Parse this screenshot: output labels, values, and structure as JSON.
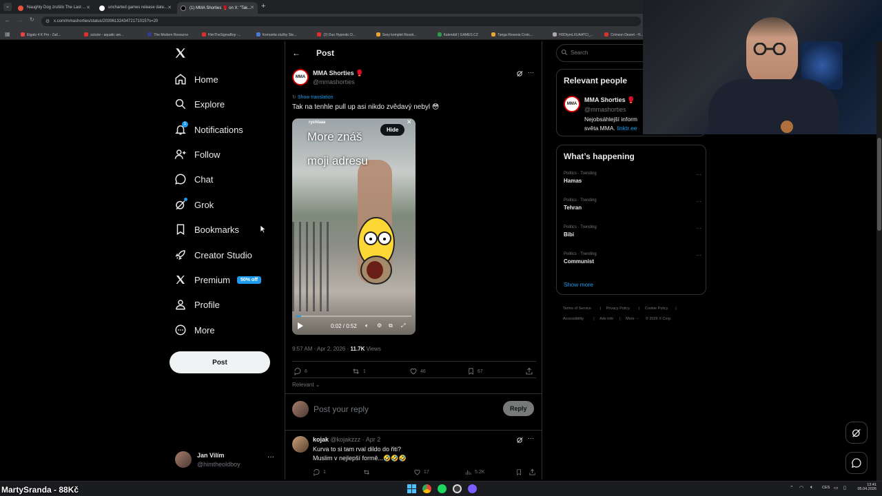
{
  "browser": {
    "tabs": [
      {
        "title": "Naughty Dog zrušilo The Last ...",
        "fav_color": "#e5533d"
      },
      {
        "title": "uncharted games release date...",
        "fav_color": "#ffffff"
      },
      {
        "title": "(1) MMA Shorties 🥊 on X: \"Tak...",
        "fav_color": "#000000"
      }
    ],
    "url": "x.com/mmashorties/status/2039613243472171015?s=20",
    "bookmarks": [
      {
        "label": "Elgato 4 K Pro - Zač...",
        "color": "#e94343"
      },
      {
        "label": "scizzie - aquatic am...",
        "color": "#e02f2f"
      },
      {
        "label": "The Modern Resource",
        "color": "#333a8f"
      },
      {
        "label": "HimTheSigmaBoy -...",
        "color": "#e02f2f"
      },
      {
        "label": "Komunita služby Ste...",
        "color": "#4c7bd6"
      },
      {
        "label": "(2) Duo Hypnotic D...",
        "color": "#e02f2f"
      },
      {
        "label": "Sexy komplet Roxeii...",
        "color": "#e8a531"
      },
      {
        "label": "Kalendář | GAMES.CZ",
        "color": "#2e9b4c"
      },
      {
        "label": "Tanga Roxenia Crotc...",
        "color": "#e8a531"
      },
      {
        "label": "HDDtymLXUAATCl_...",
        "color": "#aaaaaa"
      },
      {
        "label": "Crimson Desert - H...",
        "color": "#e02f2f"
      },
      {
        "label": "CRIMSON DESERT",
        "color": "#e02f2f"
      }
    ]
  },
  "nav": {
    "items": [
      {
        "label": "Home",
        "icon": "home-icon"
      },
      {
        "label": "Explore",
        "icon": "search-icon"
      },
      {
        "label": "Notifications",
        "icon": "bell-icon"
      },
      {
        "label": "Follow",
        "icon": "follow-icon"
      },
      {
        "label": "Chat",
        "icon": "chat-icon"
      },
      {
        "label": "Grok",
        "icon": "grok-icon"
      },
      {
        "label": "Bookmarks",
        "icon": "bookmark-icon"
      },
      {
        "label": "Creator Studio",
        "icon": "rocket-icon"
      },
      {
        "label": "Premium",
        "icon": "x-logo-icon"
      },
      {
        "label": "Profile",
        "icon": "person-icon"
      },
      {
        "label": "More",
        "icon": "more-circle-icon"
      }
    ],
    "notification_count": "1",
    "premium_badge": "50% off",
    "post_button": "Post",
    "account": {
      "name": "Jan Vilím",
      "handle": "@himtheoldboy"
    }
  },
  "post": {
    "header_title": "Post",
    "author_name": "MMA Shorties 🥊",
    "author_handle": "@mmashorties",
    "avatar_text": "MMA",
    "show_translation": "Show translation",
    "text": "Tak na tenhle pull up asi nikdo zvědavý nebyl 😳",
    "video": {
      "watermark": "rychlaaa",
      "caption_line1": "More znáš",
      "caption_line2": "moji adresu",
      "hide_label": "Hide",
      "time": "0:02 / 0:52",
      "progress": 0.04
    },
    "timestamp": "9:57 AM · Apr 2, 2026 · ",
    "views_count": "11.7K",
    "views_label": " Views",
    "replies": "6",
    "reposts": "1",
    "likes": "46",
    "bookmarks": "67",
    "sort_label": "Relevant",
    "reply_placeholder": "Post your reply",
    "reply_button": "Reply"
  },
  "comment": {
    "name": "kojak",
    "handle": "@kojakzzz",
    "date": "· Apr 2",
    "line1": "Kurva to si tam rval dildo do řiti?",
    "line2": "Muslim v nejlepší formě...🤣🤣🤣",
    "replies": "1",
    "likes": "17",
    "views": "5.2K"
  },
  "sidebar": {
    "search_placeholder": "Search",
    "relevant_title": "Relevant people",
    "person_name": "MMA Shorties 🥊",
    "person_handle": "@mmashorties",
    "person_bio_1": "Nejobsáhlejší inform",
    "person_bio_2": "světa MMA.",
    "person_link": "linktr.ee",
    "happening_title": "What’s happening",
    "trends": [
      {
        "category": "Politics · Trending",
        "name": "Hamas"
      },
      {
        "category": "Politics · Trending",
        "name": "Tehran"
      },
      {
        "category": "Politics · Trending",
        "name": "Bibi"
      },
      {
        "category": "Politics · Trending",
        "name": "Communist"
      }
    ],
    "show_more": "Show more",
    "footer": [
      "Terms of Service",
      "|",
      "Privacy Policy",
      "|",
      "Cookie Policy",
      "|",
      "Accessibility",
      "|",
      "Ads info",
      "|",
      "More ···",
      "© 2026 X Corp."
    ]
  },
  "overlay": {
    "donation_text": "MartySranda - 88Kč"
  },
  "taskbar": {
    "lang": "CES",
    "time": "13:41",
    "date": "05.04.2026"
  },
  "colors": {
    "accent": "#1d9bf0",
    "bg": "#000000",
    "border": "#2f3336",
    "muted": "#71767b"
  }
}
